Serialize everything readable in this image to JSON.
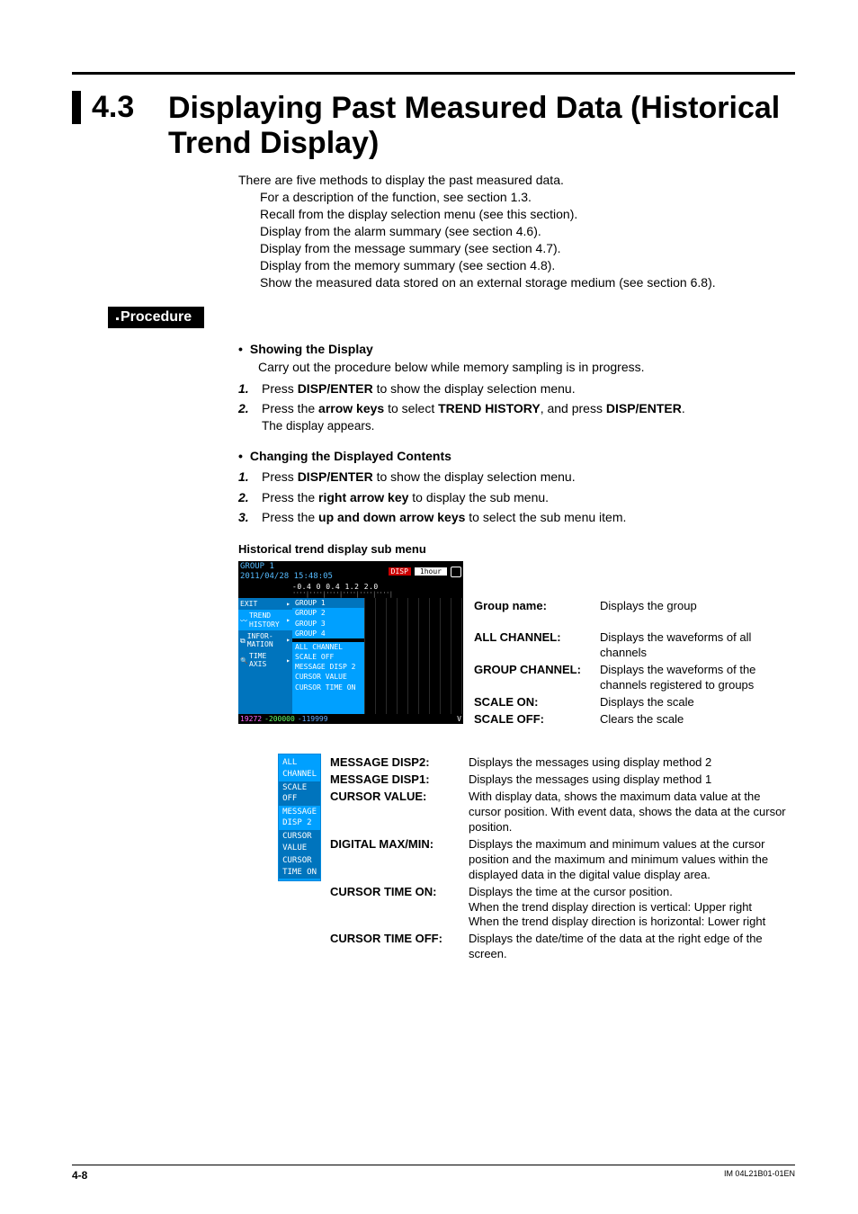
{
  "section_number": "4.3",
  "section_title": "Displaying Past Measured Data (Historical Trend Display)",
  "intro_lead": "There are five methods to display the past measured data.",
  "intro_lines": [
    "For a description of the function, see section 1.3.",
    "Recall from the display selection menu (see this section).",
    "Display from the alarm summary (see section 4.6).",
    "Display from the message summary (see section 4.7).",
    "Display from the memory summary (see section 4.8).",
    "Show the measured data stored on an external storage medium (see section 6.8)."
  ],
  "procedure_label": "Procedure",
  "show_heading": "Showing the Display",
  "show_lead": "Carry out the procedure below while memory sampling is in progress.",
  "show_steps": [
    {
      "n": "1.",
      "pre": "Press ",
      "b1": "DISP/ENTER",
      "post": " to show the display selection menu."
    },
    {
      "n": "2.",
      "pre": "Press the ",
      "b1": "arrow keys",
      "mid": " to select ",
      "b2": "TREND HISTORY",
      "mid2": ", and press ",
      "b3": "DISP/ENTER",
      "post": "."
    }
  ],
  "show_note": "The display appears.",
  "change_heading": "Changing the Displayed Contents",
  "change_steps": [
    {
      "n": "1.",
      "pre": "Press ",
      "b1": "DISP/ENTER",
      "post": " to show the display selection menu."
    },
    {
      "n": "2.",
      "pre": "Press the ",
      "b1": "right arrow key",
      "post": " to display the sub menu."
    },
    {
      "n": "3.",
      "pre": "Press the ",
      "b1": "up and down arrow keys",
      "post": " to select the sub menu item."
    }
  ],
  "submenu_title": "Historical trend display sub menu",
  "screenshot": {
    "group_title": "GROUP 1",
    "datetime": "2011/04/28 15:48:05",
    "disp_badge": "DISP",
    "interval": "1hour",
    "scale_ticks": "-0.4   0   0.4       1.2     2.0",
    "side": {
      "exit": "EXIT",
      "trend": "TREND HISTORY",
      "info": "INFOR-MATION",
      "time": "TIME AXIS"
    },
    "submenu": [
      "GROUP 1",
      "GROUP 2",
      "GROUP 3",
      "GROUP 4",
      "ALL CHANNEL",
      "SCALE OFF",
      "MESSAGE DISP 2",
      "CURSOR VALUE",
      "CURSOR TIME ON"
    ],
    "values": {
      "a": "19272",
      "b": "-200000",
      "c": "-119999",
      "unit": "V"
    }
  },
  "top_desc": [
    {
      "label": "Group name:",
      "desc": "Displays the group"
    },
    {
      "label": "ALL CHANNEL:",
      "desc": "Displays the waveforms of all channels"
    },
    {
      "label": "GROUP CHANNEL:",
      "desc": "Displays the waveforms of the channels registered to groups"
    },
    {
      "label": "SCALE ON:",
      "desc": "Displays the scale"
    },
    {
      "label": "SCALE OFF:",
      "desc": "Clears the scale"
    }
  ],
  "submenu2": [
    "ALL CHANNEL",
    "SCALE OFF",
    "MESSAGE DISP 2",
    "CURSOR VALUE",
    "CURSOR TIME ON"
  ],
  "bottom_desc": [
    {
      "label": "MESSAGE DISP2:",
      "desc": "Displays the messages using display method 2"
    },
    {
      "label": "MESSAGE DISP1:",
      "desc": "Displays the messages using display method 1"
    },
    {
      "label": "CURSOR VALUE:",
      "desc": "With display data, shows the maximum data value at the cursor position. With event data, shows the data at the cursor position."
    },
    {
      "label": "DIGITAL MAX/MIN:",
      "desc": "Displays the maximum and minimum values at the cursor position and the maximum and minimum values within the displayed data in the digital value display area."
    },
    {
      "label": "CURSOR TIME ON:",
      "desc": "Displays the time at the cursor position.\nWhen the trend display direction is vertical: Upper right\nWhen the trend display direction is horizontal: Lower right"
    },
    {
      "label": "CURSOR TIME OFF:",
      "desc": "Displays the date/time of the data at the right edge of the screen."
    }
  ],
  "footer": {
    "page": "4-8",
    "doc": "IM 04L21B01-01EN"
  }
}
